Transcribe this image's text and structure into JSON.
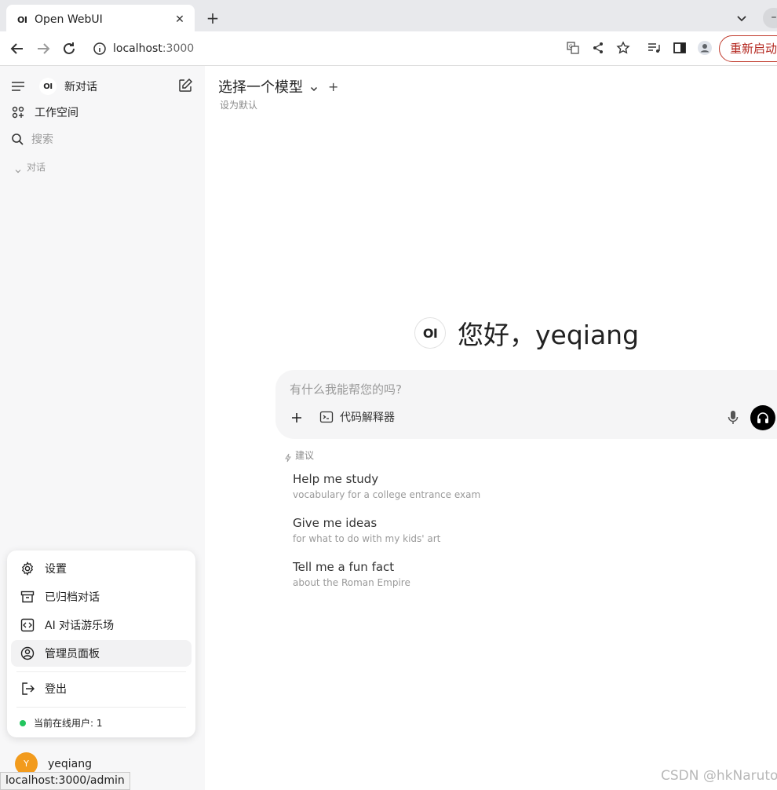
{
  "browser": {
    "tab_favicon": "OI",
    "tab_title": "Open WebUI",
    "url_host": "localhost",
    "url_port": ":3000",
    "restart_label": "重新启动",
    "status_url": "localhost:3000/admin"
  },
  "sidebar": {
    "logo": "OI",
    "new_chat": "新对话",
    "workspace": "工作空间",
    "search_placeholder": "搜索",
    "chats_section": "对话",
    "menu": {
      "settings": "设置",
      "archived": "已归档对话",
      "playground": "AI 对话游乐场",
      "admin": "管理员面板",
      "logout": "登出",
      "online_users": "当前在线用户: 1"
    },
    "user": {
      "avatar_initial": "Y",
      "name": "yeqiang"
    }
  },
  "main": {
    "model_selector": "选择一个模型",
    "set_default": "设为默认",
    "greeting_logo": "OI",
    "greeting": "您好，yeqiang",
    "composer_placeholder": "有什么我能帮您的吗?",
    "code_interpreter": "代码解释器",
    "suggestions_label": "建议",
    "suggestions": [
      {
        "title": "Help me study",
        "subtitle": "vocabulary for a college entrance exam"
      },
      {
        "title": "Give me ideas",
        "subtitle": "for what to do with my kids' art"
      },
      {
        "title": "Tell me a fun fact",
        "subtitle": "about the Roman Empire"
      }
    ]
  },
  "watermark": "CSDN @hkNaruto",
  "colors": {
    "accent_restart": "#b3261e",
    "online_dot": "#22c55e",
    "avatar": "#f29b1d",
    "sidebar_bg": "#f7f7f8"
  }
}
